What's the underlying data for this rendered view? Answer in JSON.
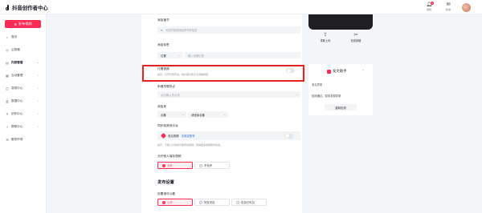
{
  "app": {
    "title": "抖音创作者中心"
  },
  "topbar": {
    "icons": [
      {
        "name": "bell-icon",
        "label": "通知",
        "badge": "2"
      },
      {
        "name": "chat-icon",
        "label": "私信"
      }
    ]
  },
  "sidebar": {
    "publish_label": "发布视频",
    "items": [
      {
        "icon": "⌂",
        "icon_name": "home-icon",
        "label": "首页"
      },
      {
        "icon": "◎",
        "icon_name": "cloud-clip-icon",
        "label": "云剪辑"
      },
      {
        "icon": "▤",
        "icon_name": "content-icon",
        "label": "内容管理",
        "chev": "⌄",
        "active": true
      },
      {
        "icon": "▦",
        "icon_name": "interaction-icon",
        "label": "互动管理",
        "chev": "⌄"
      },
      {
        "icon": "◫",
        "icon_name": "monetize-icon",
        "label": "变现中心",
        "chev": "⌄"
      },
      {
        "icon": "▥",
        "icon_name": "data-icon",
        "label": "数据中心",
        "chev": "⌄"
      },
      {
        "icon": "✎",
        "icon_name": "creator-icon",
        "label": "创作中心",
        "chev": "⌄"
      },
      {
        "icon": "?",
        "icon_name": "help-icon",
        "label": "帮助中心",
        "chev": "⌄"
      },
      {
        "icon": "☰",
        "icon_name": "service-icon",
        "label": "服务市场"
      }
    ]
  },
  "form": {
    "chapter": {
      "label": "添加章节",
      "placeholder": "为您的视频添加章节和描述"
    },
    "tag": {
      "label": "添加标签",
      "select": "位置",
      "placeholder": "输入地理位置"
    },
    "paid": {
      "label": "付费视频",
      "hint": "提示：打开付费开关，用户需付费才可观看视频"
    },
    "hotspot": {
      "label": "申请关联热点",
      "placeholder": "点击输入热点词"
    },
    "collection": {
      "label": "添加到",
      "select1": "合集",
      "select2": "请选择合集"
    },
    "sync": {
      "label": "同步到其他平台",
      "platform": "西瓜视频",
      "link": "去绑定账号",
      "hint": "提示：不能入计划也可能申请视频，获得更多视频曝光机会。"
    },
    "save": {
      "label": "允许他人保存视频",
      "allow": "允许",
      "deny": "不允许"
    }
  },
  "publish_settings": {
    "title": "发布设置",
    "visibility_label": "设置谁可以看",
    "options": [
      "公开",
      "好友可见",
      "仅自己可见"
    ]
  },
  "right_panel": {
    "tools": [
      {
        "glyph": "⇪",
        "name": "reupload-icon",
        "label": "重新上传"
      },
      {
        "glyph": "✂",
        "name": "clip-icon",
        "label": "在线剪辑"
      }
    ],
    "assistant": {
      "title": "发文助手",
      "status": "未见异常",
      "detail": "检测通过，暂未发现异常",
      "recheck": "重新检测"
    }
  },
  "colors": {
    "accent": "#fe2c55",
    "highlight": "#e8201f",
    "link": "#2d6ee6"
  }
}
